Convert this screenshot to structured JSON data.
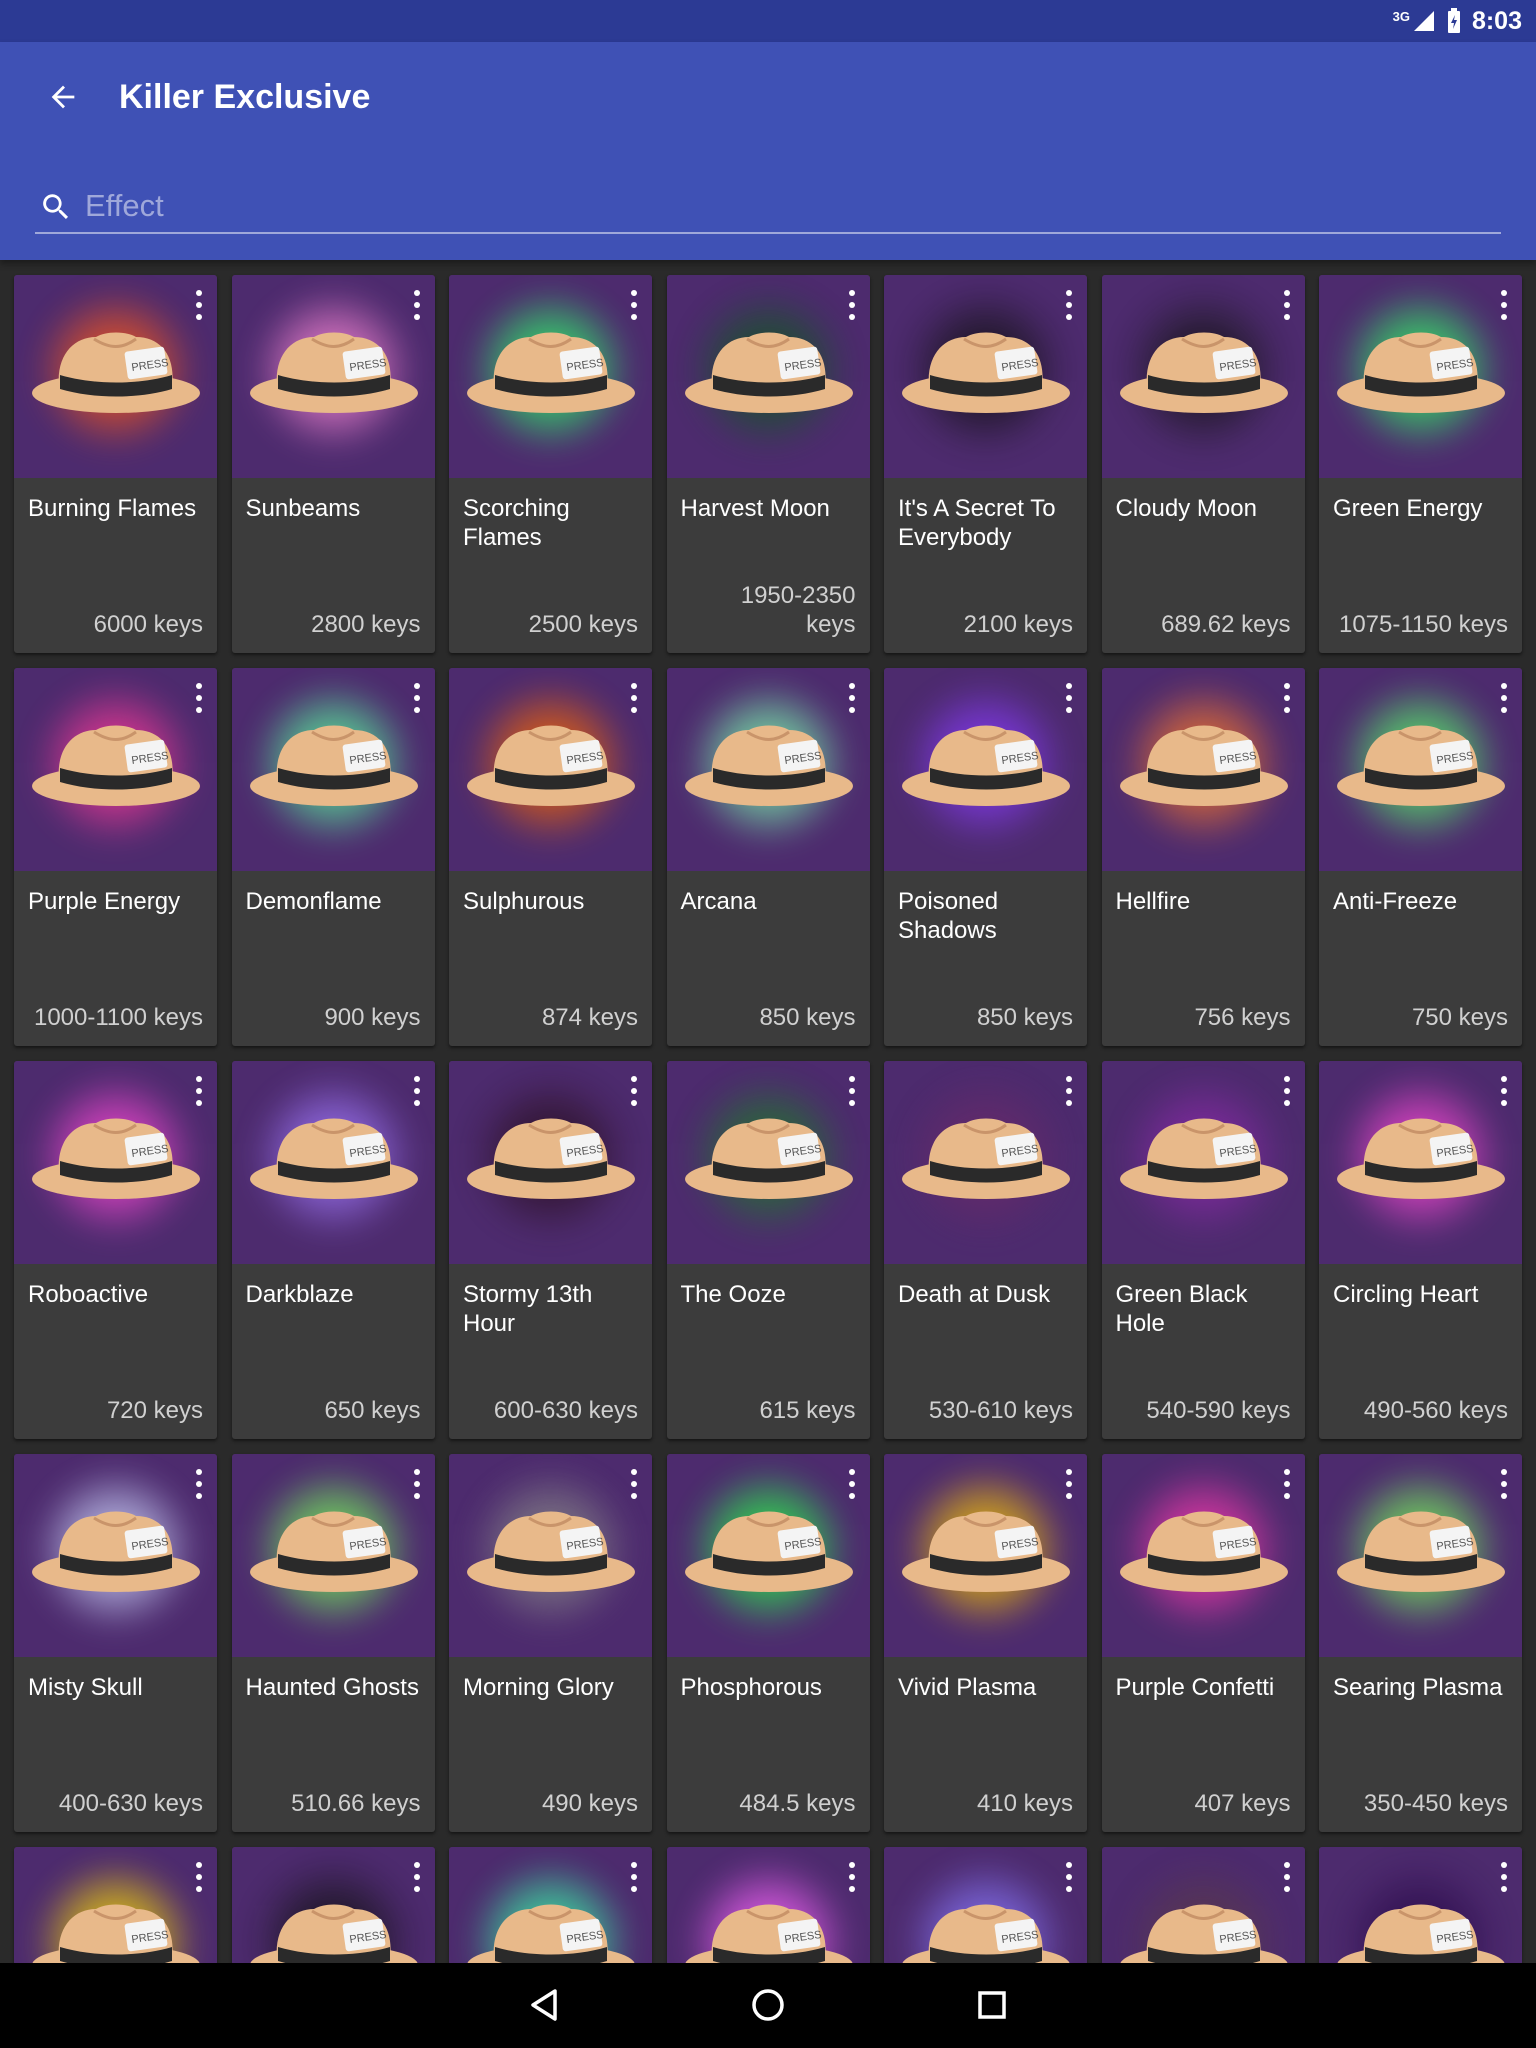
{
  "status": {
    "time": "8:03",
    "network": "3G"
  },
  "header": {
    "title": "Killer Exclusive"
  },
  "search": {
    "placeholder": "Effect",
    "value": ""
  },
  "colors": {
    "appbar": "#3f51b5",
    "statusbar": "#2c3a94",
    "card": "#3c3c3c",
    "thumb_bg": "#4d2b6e",
    "hat": "#e8b98a",
    "band": "#2a2a2a"
  },
  "items": [
    {
      "name": "Burning Flames",
      "price": "6000 keys",
      "effect_color": "#ff5a1a"
    },
    {
      "name": "Sunbeams",
      "price": "2800 keys",
      "effect_color": "#ff8ad8"
    },
    {
      "name": "Scorching Flames",
      "price": "2500 keys",
      "effect_color": "#2fff6a"
    },
    {
      "name": "Harvest Moon",
      "price": "1950-2350 keys",
      "effect_color": "#0f5a1f"
    },
    {
      "name": "It's A Secret To Everybody",
      "price": "2100 keys",
      "effect_color": "#111111"
    },
    {
      "name": "Cloudy Moon",
      "price": "689.62 keys",
      "effect_color": "#151515"
    },
    {
      "name": "Green Energy",
      "price": "1075-1150 keys",
      "effect_color": "#33ff66"
    },
    {
      "name": "Purple Energy",
      "price": "1000-1100 keys",
      "effect_color": "#ff3a9a"
    },
    {
      "name": "Demonflame",
      "price": "900 keys",
      "effect_color": "#5cffa0"
    },
    {
      "name": "Sulphurous",
      "price": "874 keys",
      "effect_color": "#ff6a00"
    },
    {
      "name": "Arcana",
      "price": "850 keys",
      "effect_color": "#7fffb0"
    },
    {
      "name": "Poisoned Shadows",
      "price": "850 keys",
      "effect_color": "#8a3cff"
    },
    {
      "name": "Hellfire",
      "price": "756 keys",
      "effect_color": "#ff7a2a"
    },
    {
      "name": "Anti-Freeze",
      "price": "750 keys",
      "effect_color": "#5aff6a"
    },
    {
      "name": "Roboactive",
      "price": "720 keys",
      "effect_color": "#ff4ad8"
    },
    {
      "name": "Darkblaze",
      "price": "650 keys",
      "effect_color": "#a27aff"
    },
    {
      "name": "Stormy 13th Hour",
      "price": "600-630 keys",
      "effect_color": "#2a0f1f"
    },
    {
      "name": "The Ooze",
      "price": "615 keys",
      "effect_color": "#1f7a2a"
    },
    {
      "name": "Death at Dusk",
      "price": "530-610 keys",
      "effect_color": "#6a2a6a"
    },
    {
      "name": "Green Black Hole",
      "price": "540-590 keys",
      "effect_color": "#8a2aa8"
    },
    {
      "name": "Circling Heart",
      "price": "490-560 keys",
      "effect_color": "#ff4ad8"
    },
    {
      "name": "Misty Skull",
      "price": "400-630 keys",
      "effect_color": "#d0d8ff"
    },
    {
      "name": "Haunted Ghosts",
      "price": "510.66 keys",
      "effect_color": "#7aff5a"
    },
    {
      "name": "Morning Glory",
      "price": "490 keys",
      "effect_color": "#8a8a8a"
    },
    {
      "name": "Phosphorous",
      "price": "484.5 keys",
      "effect_color": "#2aff4a"
    },
    {
      "name": "Vivid Plasma",
      "price": "410 keys",
      "effect_color": "#ffcc00"
    },
    {
      "name": "Purple Confetti",
      "price": "407 keys",
      "effect_color": "#ff3ab0"
    },
    {
      "name": "Searing Plasma",
      "price": "350-450 keys",
      "effect_color": "#7aff5a"
    },
    {
      "name": "",
      "price": "",
      "effect_color": "#ffe000"
    },
    {
      "name": "",
      "price": "",
      "effect_color": "#111111"
    },
    {
      "name": "",
      "price": "",
      "effect_color": "#3affaa"
    },
    {
      "name": "",
      "price": "",
      "effect_color": "#ff66ff"
    },
    {
      "name": "",
      "price": "",
      "effect_color": "#8a7aff"
    },
    {
      "name": "",
      "price": "",
      "effect_color": "#5a3a4a"
    },
    {
      "name": "",
      "price": "",
      "effect_color": "#2a0a4a"
    }
  ],
  "nav": {
    "back": "back-icon",
    "home": "home-icon",
    "recents": "recents-icon"
  }
}
